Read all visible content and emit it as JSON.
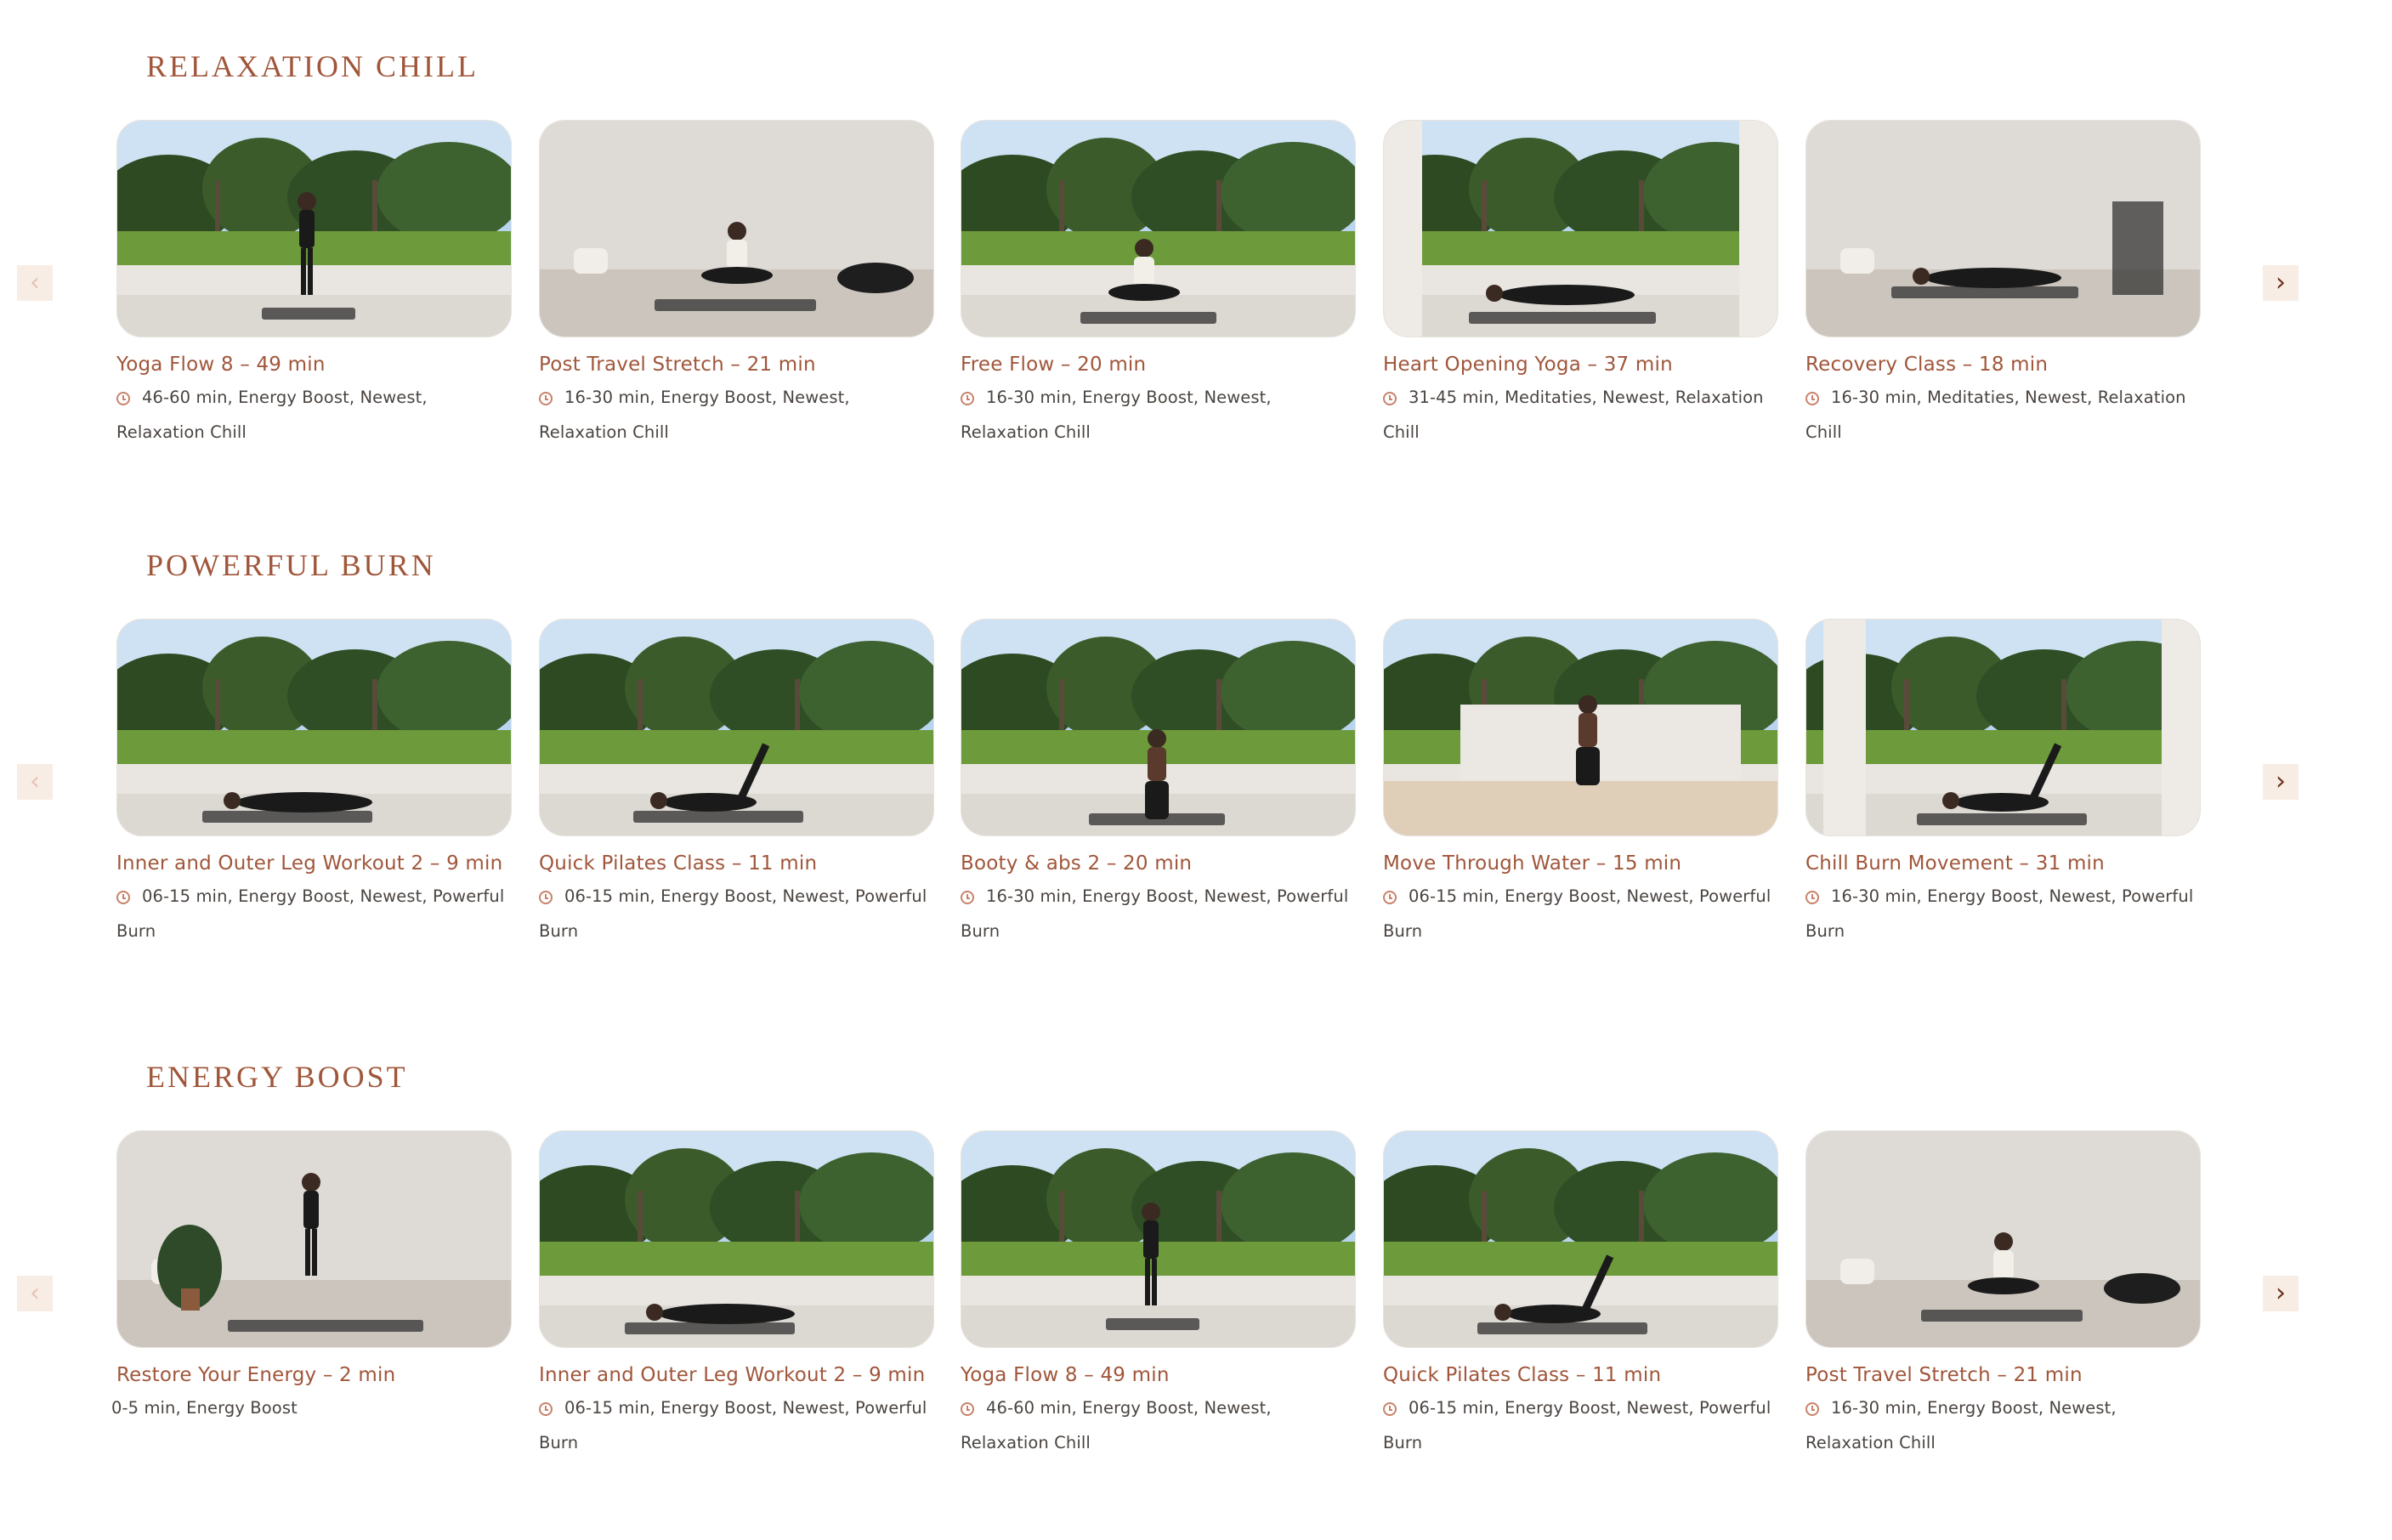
{
  "sections": [
    {
      "title": "RELAXATION CHILL",
      "cards": [
        {
          "title": "Yoga Flow 8 – 49 min",
          "meta": "46-60 min, Energy Boost, Newest, Relaxation Chill",
          "scene": "garden-balance"
        },
        {
          "title": "Post Travel Stretch – 21 min",
          "meta": "16-30 min, Energy Boost, Newest, Relaxation Chill",
          "scene": "studio-seated"
        },
        {
          "title": "Free Flow – 20 min",
          "meta": "16-30 min, Energy Boost, Newest, Relaxation Chill",
          "scene": "garden-stretch"
        },
        {
          "title": "Heart Opening Yoga – 37 min",
          "meta": "31-45 min, Meditaties, Newest, Relaxation Chill",
          "scene": "terrace-lying"
        },
        {
          "title": "Recovery Class – 18 min",
          "meta": "16-30 min, Meditaties, Newest, Relaxation Chill",
          "scene": "studio-lying"
        }
      ]
    },
    {
      "title": "POWERFUL BURN",
      "cards": [
        {
          "title": "Inner and Outer Leg Workout 2 – 9 min",
          "meta": "06-15 min, Energy Boost, Newest, Powerful Burn",
          "scene": "garden-lying"
        },
        {
          "title": "Quick Pilates Class – 11 min",
          "meta": "06-15 min, Energy Boost, Newest, Powerful Burn",
          "scene": "garden-legs"
        },
        {
          "title": "Booty & abs 2 – 20 min",
          "meta": "16-30 min, Energy Boost, Newest, Powerful Burn",
          "scene": "garden-kneel"
        },
        {
          "title": "Move Through Water – 15 min",
          "meta": "06-15 min, Energy Boost, Newest, Powerful Burn",
          "scene": "wall-lunge"
        },
        {
          "title": "Chill Burn Movement – 31 min",
          "meta": "16-30 min, Energy Boost, Newest, Powerful Burn",
          "scene": "terrace-legup"
        }
      ]
    },
    {
      "title": "ENERGY BOOST",
      "cards": [
        {
          "title": "Restore Your Energy – 2 min",
          "meta": "0-5 min, Energy Boost",
          "scene": "studio-standing"
        },
        {
          "title": "Inner and Outer Leg Workout 2 – 9 min",
          "meta": "06-15 min, Energy Boost, Newest, Powerful Burn",
          "scene": "garden-lying"
        },
        {
          "title": "Yoga Flow 8 – 49 min",
          "meta": "46-60 min, Energy Boost, Newest, Relaxation Chill",
          "scene": "garden-balance"
        },
        {
          "title": "Quick Pilates Class – 11 min",
          "meta": "06-15 min, Energy Boost, Newest, Powerful Burn",
          "scene": "garden-legs"
        },
        {
          "title": "Post Travel Stretch – 21 min",
          "meta": "16-30 min, Energy Boost, Newest, Relaxation Chill",
          "scene": "studio-seated"
        }
      ]
    }
  ],
  "nav": {
    "prev_glyph": "‹",
    "next_glyph": "›"
  },
  "colors": {
    "accent": "#a0563a",
    "arrow_bg": "#f8ede5",
    "text": "#4a4440"
  }
}
